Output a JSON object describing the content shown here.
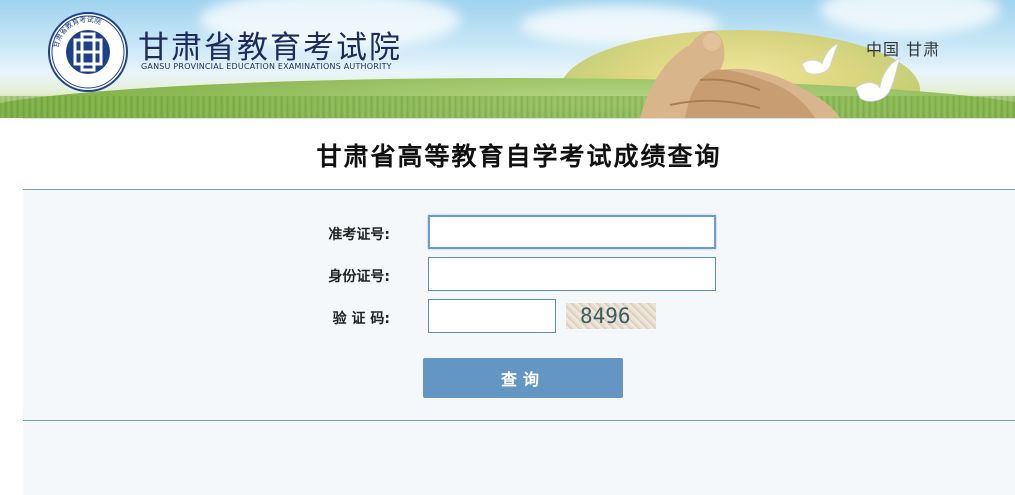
{
  "header": {
    "org_name": "甘肃省教育考试院",
    "org_name_en": "GANSU PROVINCIAL EDUCATION EXAMINATIONS AUTHORITY",
    "logo_ring_text": "甘肃省教育考试院",
    "region": "中国  甘肃"
  },
  "page": {
    "title": "甘肃省高等教育自学考试成绩查询"
  },
  "form": {
    "exam_id": {
      "label": "准考证号:",
      "value": "",
      "placeholder": ""
    },
    "id_card": {
      "label": "身份证号:",
      "value": "",
      "placeholder": ""
    },
    "captcha": {
      "label": "验 证 码:",
      "value": "",
      "placeholder": "",
      "image_text": "8496"
    },
    "submit_label": "查询"
  },
  "colors": {
    "brand_navy": "#1e2a5c",
    "button_blue": "#6496c3",
    "rule_blue": "#6da3c3",
    "panel_bg": "#f4f8fb"
  },
  "icons": [
    "gansu-exam-authority-logo",
    "statue-mother-river",
    "dove-icon"
  ]
}
